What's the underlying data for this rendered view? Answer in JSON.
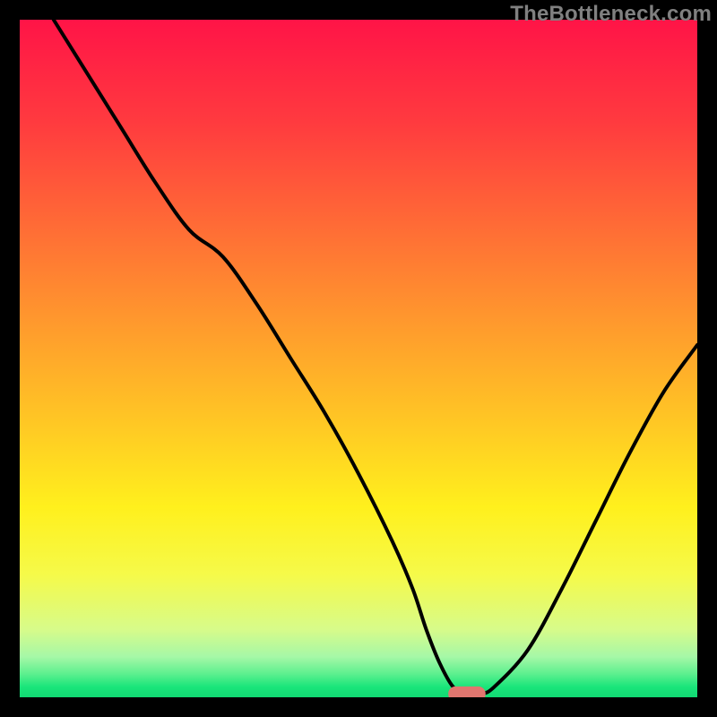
{
  "watermark": "TheBottleneck.com",
  "colors": {
    "frame": "#000000",
    "curve": "#000000",
    "marker": "#e0766f",
    "gradient_stops": [
      {
        "offset": 0.0,
        "color": "#ff1447"
      },
      {
        "offset": 0.15,
        "color": "#ff3a3f"
      },
      {
        "offset": 0.3,
        "color": "#ff6a36"
      },
      {
        "offset": 0.45,
        "color": "#ff9a2d"
      },
      {
        "offset": 0.6,
        "color": "#ffc924"
      },
      {
        "offset": 0.72,
        "color": "#fff01d"
      },
      {
        "offset": 0.82,
        "color": "#f5fa4a"
      },
      {
        "offset": 0.9,
        "color": "#d7fb8a"
      },
      {
        "offset": 0.94,
        "color": "#a6f8a7"
      },
      {
        "offset": 0.965,
        "color": "#5ef08f"
      },
      {
        "offset": 0.985,
        "color": "#19e57a"
      },
      {
        "offset": 1.0,
        "color": "#11d873"
      }
    ]
  },
  "chart_data": {
    "type": "line",
    "title": "",
    "xlabel": "",
    "ylabel": "",
    "xlim": [
      0,
      100
    ],
    "ylim": [
      0,
      100
    ],
    "x": [
      5,
      10,
      15,
      20,
      25,
      30,
      35,
      40,
      45,
      50,
      55,
      58,
      60,
      62,
      64,
      66,
      68,
      70,
      75,
      80,
      85,
      90,
      95,
      100
    ],
    "series": [
      {
        "name": "bottleneck-curve",
        "values": [
          100,
          92,
          84,
          76,
          69,
          65,
          58,
          50,
          42,
          33,
          23,
          16,
          10,
          5,
          1.5,
          0.5,
          0.5,
          1.5,
          7,
          16,
          26,
          36,
          45,
          52
        ]
      }
    ],
    "marker": {
      "x": 66,
      "y": 0.5,
      "w": 5.5,
      "h": 2.2
    }
  }
}
